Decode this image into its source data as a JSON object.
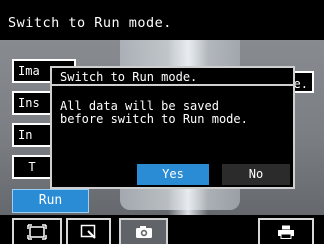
{
  "header": {
    "title": "Switch to Run mode."
  },
  "side_menu": {
    "items": [
      {
        "label": "Ima"
      },
      {
        "label": "Ins"
      },
      {
        "label": "In"
      },
      {
        "label": "T"
      }
    ],
    "run_label": "Run"
  },
  "right_fragment": {
    "label": "e."
  },
  "toolbar": {
    "items": [
      {
        "icon": "frame-icon"
      },
      {
        "icon": "zoom-window-icon"
      },
      {
        "icon": "camera-icon"
      },
      {
        "icon": "printer-icon"
      }
    ]
  },
  "dialog": {
    "title": "Switch to Run mode.",
    "message": "All data will be saved\nbefore switch to Run mode.",
    "yes_label": "Yes",
    "no_label": "No"
  },
  "colors": {
    "accent_blue": "#2a8cd4",
    "background": "#000000",
    "border": "#cfcfcf"
  }
}
